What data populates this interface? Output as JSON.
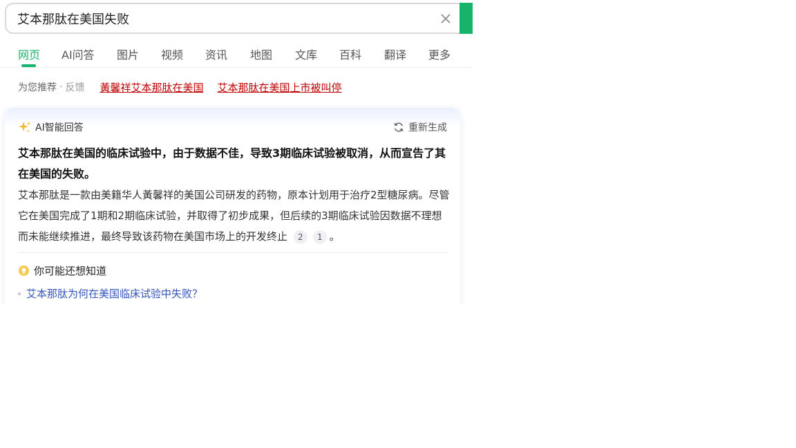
{
  "search": {
    "query": "艾本那肽在美国失败"
  },
  "tabs": [
    {
      "label": "网页"
    },
    {
      "label": "AI问答"
    },
    {
      "label": "图片"
    },
    {
      "label": "视频"
    },
    {
      "label": "资讯"
    },
    {
      "label": "地图"
    },
    {
      "label": "文库"
    },
    {
      "label": "百科"
    },
    {
      "label": "翻译"
    },
    {
      "label": "更多"
    }
  ],
  "recommend": {
    "label": "为您推荐",
    "feedback": "反馈",
    "links": [
      "黃馨祥艾本那肽在美国",
      "艾本那肽在美国上市被叫停"
    ]
  },
  "ai_answer": {
    "title": "AI智能回答",
    "regenerate": "重新生成",
    "summary": "艾本那肽在美国的临床试验中，由于数据不佳，导致3期临床试验被取消，从而宣告了其在美国的失败。",
    "body": "艾本那肽是一款由美籍华人黃馨祥的美国公司研发的药物，原本计划用于治疗2型糖尿病。尽管它在美国完成了1期和2期临床试验，并取得了初步成果，但后续的3期临床试验因数据不理想而未能继续推进，最终导致该药物在美国市场上的开发终止",
    "citations": [
      "2",
      "1"
    ],
    "end_punct": "。",
    "also_title": "你可能还想知道",
    "also_items": [
      "艾本那肽为何在美国临床试验中失败？"
    ]
  },
  "colors": {
    "accent": "#17b36b",
    "link_red": "#c00000",
    "link_blue": "#3355bb"
  }
}
